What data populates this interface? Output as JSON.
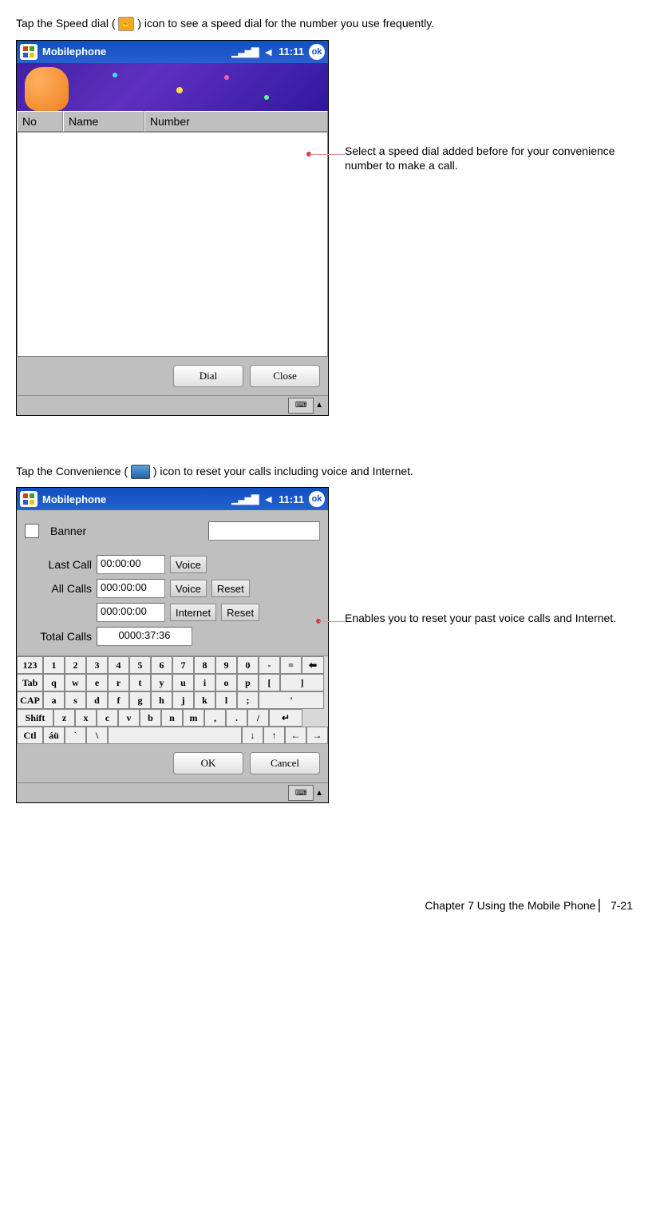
{
  "para1_a": "Tap the Speed dial (",
  "para1_b": ") icon to see a speed dial for the number you use frequently.",
  "para2_a": "Tap the Convenience (",
  "para2_b": ") icon to reset your calls including voice and Internet.",
  "callout1": "Select a speed dial added before for your convenience number to make a call.",
  "callout2": "Enables you to reset your past voice calls and Internet.",
  "device1": {
    "title": "Mobilephone",
    "signal": "▮▯▮▯▮",
    "time": "11:11",
    "ok": "ok",
    "cols": {
      "no": "No",
      "name": "Name",
      "number": "Number"
    },
    "dial": "Dial",
    "close": "Close"
  },
  "device2": {
    "title": "Mobilephone",
    "time": "11:11",
    "ok": "ok",
    "banner": "Banner",
    "last_call_lbl": "Last Call",
    "all_calls_lbl": "All Calls",
    "total_calls_lbl": "Total Calls",
    "last_call_val": "00:00:00",
    "all_calls_val1": "000:00:00",
    "all_calls_val2": "000:00:00",
    "total_val": "0000:37:36",
    "voice": "Voice",
    "internet": "Internet",
    "reset": "Reset",
    "ok_btn": "OK",
    "cancel": "Cancel"
  },
  "keyboard": {
    "r1": [
      "123",
      "1",
      "2",
      "3",
      "4",
      "5",
      "6",
      "7",
      "8",
      "9",
      "0",
      "-",
      "=",
      "⬅"
    ],
    "r2": [
      "Tab",
      "q",
      "w",
      "e",
      "r",
      "t",
      "y",
      "u",
      "i",
      "o",
      "p",
      "[",
      "]"
    ],
    "r3": [
      "CAP",
      "a",
      "s",
      "d",
      "f",
      "g",
      "h",
      "j",
      "k",
      "l",
      ";",
      "'"
    ],
    "r4": [
      "Shift",
      "z",
      "x",
      "c",
      "v",
      "b",
      "n",
      "m",
      ",",
      ".",
      "/",
      "↵"
    ],
    "r5": [
      "Ctl",
      "áü",
      "`",
      "\\",
      "",
      "↓",
      "↑",
      "←",
      "→"
    ]
  },
  "footer": "Chapter 7 Using the Mobile Phone  ▏ 7-21"
}
